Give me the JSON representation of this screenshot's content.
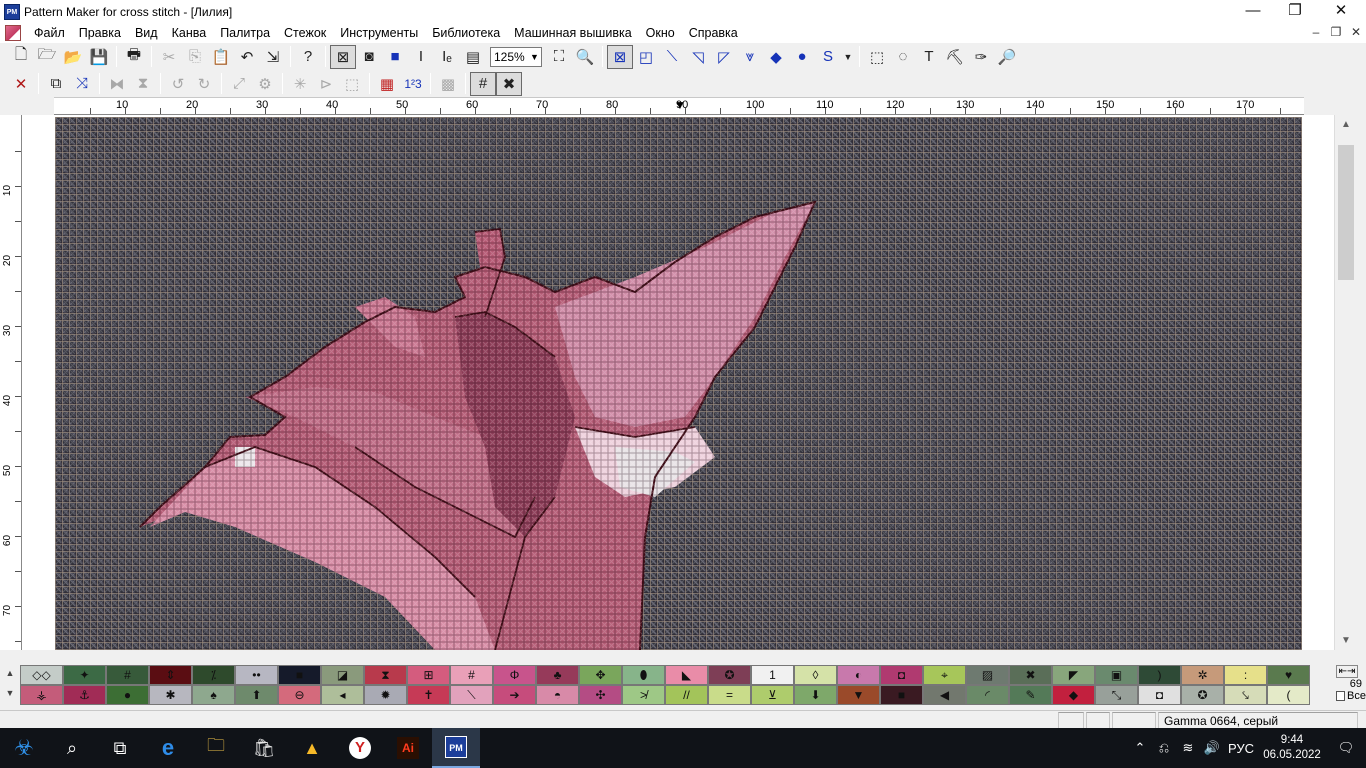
{
  "window": {
    "title": "Pattern Maker for cross stitch - [Лилия]",
    "app_icon": "PM"
  },
  "menu": [
    "Файл",
    "Правка",
    "Вид",
    "Канва",
    "Палитра",
    "Стежок",
    "Инструменты",
    "Библиотека",
    "Машинная вышивка",
    "Окно",
    "Справка"
  ],
  "toolbar": {
    "zoom": "125%"
  },
  "rulers": {
    "horizontal": [
      "10",
      "20",
      "30",
      "40",
      "50",
      "60",
      "70",
      "80",
      "90",
      "100",
      "110",
      "120",
      "130",
      "140",
      "150",
      "160",
      "170"
    ],
    "vertical": [
      "10",
      "20",
      "30",
      "40",
      "50",
      "60",
      "70"
    ]
  },
  "palette": {
    "count": "69",
    "all_label": "Все",
    "row1": [
      {
        "c": "#c4ccc8",
        "s": "◇◇"
      },
      {
        "c": "#3c6a45",
        "s": "✦"
      },
      {
        "c": "#375a3a",
        "s": "#"
      },
      {
        "c": "#5a0d12",
        "s": "⇕"
      },
      {
        "c": "#2e4a2c",
        "s": "⁒"
      },
      {
        "c": "#b7b7c2",
        "s": "••"
      },
      {
        "c": "#151a2a",
        "s": "■"
      },
      {
        "c": "#8a9a7c",
        "s": "◪"
      },
      {
        "c": "#b83a4c",
        "s": "⧗"
      },
      {
        "c": "#d45c7e",
        "s": "⊞"
      },
      {
        "c": "#e9a0b8",
        "s": "#"
      },
      {
        "c": "#c8548c",
        "s": "Φ"
      },
      {
        "c": "#963a5a",
        "s": "♣"
      },
      {
        "c": "#7aa65c",
        "s": "✥"
      },
      {
        "c": "#87b48a",
        "s": "⬮"
      },
      {
        "c": "#e98ca8",
        "s": "◣"
      },
      {
        "c": "#7e3e56",
        "s": "✪"
      },
      {
        "c": "#f1f1f1",
        "s": "1"
      },
      {
        "c": "#d5e2a8",
        "s": "◊"
      },
      {
        "c": "#c879ac",
        "s": "◐"
      },
      {
        "c": "#b03a70",
        "s": "◘"
      },
      {
        "c": "#a7c65a",
        "s": "⌖"
      },
      {
        "c": "#6e7a70",
        "s": "▨"
      },
      {
        "c": "#5a6e58",
        "s": "✖"
      },
      {
        "c": "#88a67c",
        "s": "◤"
      },
      {
        "c": "#6a8a6e",
        "s": "▣"
      },
      {
        "c": "#2e4a36",
        "s": ")"
      },
      {
        "c": "#c69a7a",
        "s": "✲"
      },
      {
        "c": "#e6e08a",
        "s": ":"
      },
      {
        "c": "#5a7a4e",
        "s": "♥"
      }
    ],
    "row2": [
      {
        "c": "#c45c7a",
        "s": "⚶"
      },
      {
        "c": "#a12c56",
        "s": "⚓"
      },
      {
        "c": "#3c6e34",
        "s": "●"
      },
      {
        "c": "#b7b7bf",
        "s": "✱"
      },
      {
        "c": "#8ea88e",
        "s": "♠"
      },
      {
        "c": "#6e8a6c",
        "s": "⬆"
      },
      {
        "c": "#d46a7c",
        "s": "⊖"
      },
      {
        "c": "#aebe9a",
        "s": "◂"
      },
      {
        "c": "#a9aab4",
        "s": "✹"
      },
      {
        "c": "#c63a56",
        "s": "✝"
      },
      {
        "c": "#e2a2bc",
        "s": "⟍"
      },
      {
        "c": "#c64c7c",
        "s": "➔"
      },
      {
        "c": "#d88aa8",
        "s": "◓"
      },
      {
        "c": "#b44c84",
        "s": "✣"
      },
      {
        "c": "#9ec886",
        "s": "≯"
      },
      {
        "c": "#a3c45a",
        "s": "//"
      },
      {
        "c": "#c9dc8a",
        "s": "="
      },
      {
        "c": "#aecc6c",
        "s": "⊻"
      },
      {
        "c": "#7ea86a",
        "s": "⬇"
      },
      {
        "c": "#9a4a2a",
        "s": "▼"
      },
      {
        "c": "#3a1a22",
        "s": "■"
      },
      {
        "c": "#72786e",
        "s": "◀"
      },
      {
        "c": "#6a8a68",
        "s": "◜"
      },
      {
        "c": "#547a58",
        "s": "✎"
      },
      {
        "c": "#c2203e",
        "s": "◆"
      },
      {
        "c": "#98a09a",
        "s": "⤡"
      },
      {
        "c": "#e0e0e0",
        "s": "◘"
      },
      {
        "c": "#a8b0a8",
        "s": "✪"
      },
      {
        "c": "#d6dcb8",
        "s": "⤥"
      },
      {
        "c": "#e4eac8",
        "s": "("
      }
    ]
  },
  "status": {
    "text": "Gamma  0664, серый"
  },
  "taskbar": {
    "lang": "РУС",
    "time": "9:44",
    "date": "06.05.2022"
  }
}
